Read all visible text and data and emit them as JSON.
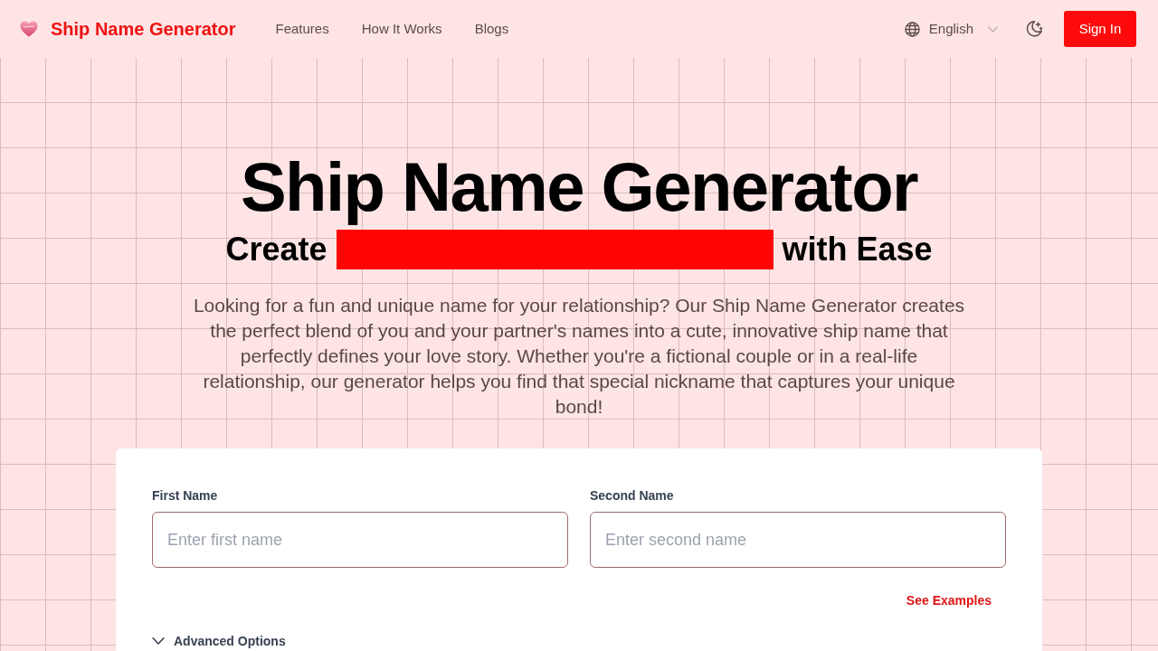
{
  "header": {
    "logo_text": "Ship Name Generator",
    "nav": [
      {
        "label": "Features"
      },
      {
        "label": "How It Works"
      },
      {
        "label": "Blogs"
      }
    ],
    "language": "English",
    "sign_in": "Sign In"
  },
  "hero": {
    "title": "Ship Name Generator",
    "subtitle_start": "Create",
    "subtitle_end": "with Ease",
    "description": "Looking for a fun and unique name for your relationship? Our Ship Name Generator creates the perfect blend of you and your partner's names into a cute, innovative ship name that perfectly defines your love story. Whether you're a fictional couple or in a real-life relationship, our generator helps you find that special nickname that captures your unique bond!"
  },
  "form": {
    "fields": [
      {
        "label": "First Name",
        "placeholder": "Enter first name"
      },
      {
        "label": "Second Name",
        "placeholder": "Enter second name"
      }
    ],
    "examples_link": "See Examples",
    "advanced_options": {
      "label": "Advanced Options",
      "expanded": false
    }
  }
}
